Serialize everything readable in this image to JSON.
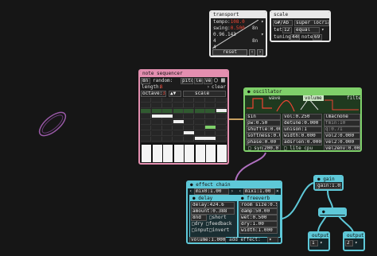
{
  "transport": {
    "title": "transport",
    "tempo_label": "tempo:",
    "tempo_value": "108.0",
    "swing_label": "swing:",
    "swing_value": "0.500",
    "time": "0.96.143",
    "beats": "4",
    "subdiv": "4",
    "div1": "8n",
    "div2": "8n",
    "reset_label": "reset"
  },
  "scale": {
    "title": "scale",
    "root": "G#/Ab",
    "mode": "super locrian",
    "tet_label": "tet",
    "tet_value": "12",
    "temperament": "equal",
    "tuning_label": "tuning",
    "tuning_value": "440",
    "note_label": "note",
    "note_value": "69"
  },
  "sequencer": {
    "title": "note sequencer",
    "rate": "8n",
    "random_label": "random:",
    "random_pitch": "pitch",
    "random_len": "len",
    "random_vel": "vel",
    "length_label": "length:",
    "length_value": "8",
    "clear_label": "clear",
    "octave_label": "octave:",
    "octave_value": "3",
    "scale_label": "scale"
  },
  "oscillator": {
    "title": "oscillator",
    "tab_wave": "wave",
    "tab_volume": "volume",
    "tab_filter": "filter",
    "wave": "sin",
    "pw": "pw:0.50",
    "shuffle": "shuffle:0.00",
    "softness": "softness:0.00",
    "phase": "phase:0.00",
    "sync_label": "sync",
    "sync_value": "200.0",
    "vol": "vol:0.250",
    "detune": "detune:0.000",
    "unison": "unison:1",
    "width": "width:0.000",
    "adsr": "adsrlen:0.000",
    "lite": "lite cpu",
    "filter_type": "lmacnone",
    "fmin": "fmin:10",
    "q": "q:0.71",
    "vol2": "vol2:0.000",
    "vel2": "vel2:0.000",
    "vel2env": "vel2env:0.00"
  },
  "effect_chain": {
    "title": "effect chain",
    "mix0": "mix0:1.00",
    "mix1": "mix1:1.00",
    "delay_title": "delay",
    "delay_value": "delay:424.6",
    "delay_feedback": "amount:0.388",
    "delay_rate": "8nd",
    "short_label": "short",
    "dry_label": "dry",
    "feedback_label": "feedback",
    "input_label": "input",
    "invert_label": "invert",
    "reverb_title": "freeverb",
    "room": "room size:0.50",
    "damp": "damp:50.00",
    "wet": "wet:0.500",
    "dry": "dry:1.00",
    "width": "width:1.000",
    "volume": "volume:1.000",
    "add_effect": "add effect:"
  },
  "gain": {
    "title": "gain",
    "value": "gain:1.000"
  },
  "splitter": {
    "title": "splitter"
  },
  "outputs": [
    {
      "title": "output",
      "channel": "1"
    },
    {
      "title": "output",
      "channel": "2"
    }
  ],
  "colors": {
    "transport": "#e8e8e8",
    "scale": "#e8e8e8",
    "sequencer": "#e48fb0",
    "oscillator": "#7fd06a",
    "effect": "#5ec8d8",
    "gain": "#5ec8d8",
    "wire_pink": "#d070b8",
    "wire_cyan": "#5ec8d8"
  }
}
